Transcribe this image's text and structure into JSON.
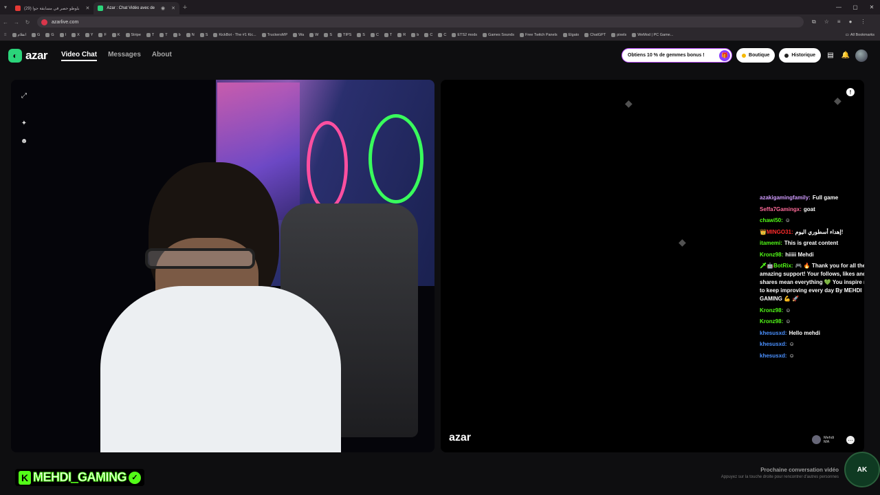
{
  "browser": {
    "tabs": [
      {
        "label": "بلوطو حصر في مسابقة جوا (29)",
        "color": "#e53935"
      },
      {
        "label": "Azar : Chat Vidéo avec de",
        "color": "#2bd47a"
      }
    ],
    "url": "azarlive.com",
    "bookmarks": [
      "انقلام",
      "G",
      "G",
      "I",
      "X",
      "Y",
      "F",
      "K",
      "Stripe",
      "T",
      "T",
      "b",
      "N",
      "S",
      "KickBot - The #1 Kic...",
      "TruckersMP",
      "Wa",
      "W",
      "S",
      "TIPS",
      "S",
      "C",
      "T",
      "R",
      "b",
      "C",
      "C",
      "ETS2 mods",
      "Games Sounds",
      "Free Twitch Panels",
      "Elgato",
      "ChatGPT",
      "pixels",
      "WeMod | PC Game..."
    ],
    "all_bookmarks": "All Bookmarks"
  },
  "header": {
    "logo_text": "azar",
    "nav": [
      {
        "label": "Video Chat",
        "active": true
      },
      {
        "label": "Messages",
        "active": false
      },
      {
        "label": "About",
        "active": false
      }
    ],
    "gems_promo": "Obtiens 10 % de gemmes bonus !",
    "shop": "Boutique",
    "history": "Historique"
  },
  "chat": [
    {
      "user": "azakigamingfamily:",
      "text": "Full game",
      "color": "#d19cff"
    },
    {
      "user": "Seffa7Gamingx:",
      "text": "goat",
      "color": "#ff6b9a"
    },
    {
      "user": "chawi50:",
      "text": "☺",
      "color": "#53fc18"
    },
    {
      "user": "👑MINGO31:",
      "text": "إهداء أسطوري اليوم!",
      "color": "#ff2b2b"
    },
    {
      "user": "itamemi:",
      "text": "This is great content",
      "color": "#53fc18"
    },
    {
      "user": "Kronz98:",
      "text": "hiiiii Mehdi",
      "color": "#53fc18"
    },
    {
      "user": "🗡🤖BotRix:",
      "text": "🎮 🔥 Thank you for all the amazing support! Your follows, likes and shares mean everything 💚 You inspire me to keep improving every day By MEHDI GAMING 💪 🚀",
      "color": "#53fc18"
    },
    {
      "user": "Kronz98:",
      "text": "☺",
      "color": "#53fc18"
    },
    {
      "user": "Kronz98:",
      "text": "☺",
      "color": "#53fc18"
    },
    {
      "user": "khesusxd:",
      "text": "Hello mehdi",
      "color": "#4a90ff"
    },
    {
      "user": "khesusxd:",
      "text": "☺",
      "color": "#4a90ff"
    },
    {
      "user": "khesusxd:",
      "text": "☺",
      "color": "#4a90ff"
    }
  ],
  "peer": {
    "name": "Mehdi",
    "country": "MA"
  },
  "watermark": "azar",
  "next": {
    "title": "Prochaine conversation vidéo",
    "hint": "Appuyez sur la touche droite pour rencontrer d'autres personnes"
  },
  "streamer": "MEHDI_GAMING",
  "corner_logo": "AK"
}
